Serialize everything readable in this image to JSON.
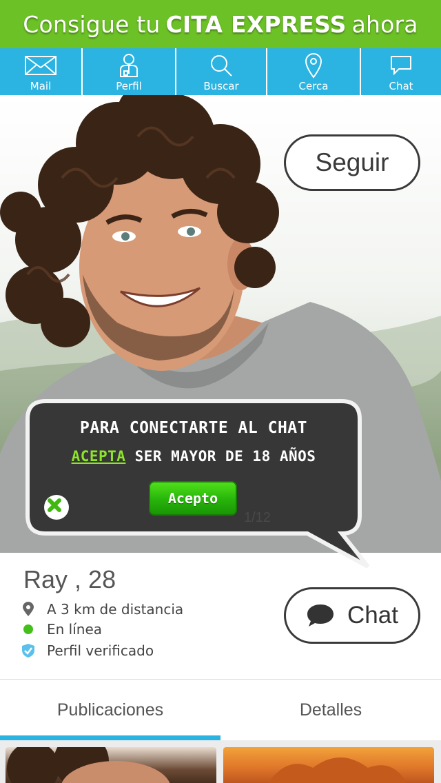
{
  "banner": {
    "text_pre": "Consigue tu",
    "text_bold": "CITA EXPRESS",
    "text_post": "ahora"
  },
  "nav": {
    "items": [
      {
        "label": "Mail",
        "icon": "mail-icon"
      },
      {
        "label": "Perfil",
        "icon": "profile-icon"
      },
      {
        "label": "Buscar",
        "icon": "search-icon"
      },
      {
        "label": "Cerca",
        "icon": "location-pin-icon"
      },
      {
        "label": "Chat",
        "icon": "chat-bubble-icon"
      }
    ]
  },
  "profile": {
    "follow_label": "Seguir",
    "name": "Ray",
    "age_text": ", 28",
    "distance": "A 3 km de distancia",
    "status": "En línea",
    "verified": "Perfil verificado",
    "chat_label": "Chat",
    "photo_counter": "1/12"
  },
  "modal": {
    "line1": "Para conectarte al chat",
    "accept_word": "Acepta",
    "line2_rest": " ser mayor de 18 años",
    "accept_button": "Acepto"
  },
  "tabs": [
    {
      "label": "Publicaciones",
      "active": true
    },
    {
      "label": "Detalles",
      "active": false
    }
  ],
  "colors": {
    "banner_green": "#6cc126",
    "nav_blue": "#2bb3e1",
    "online_green": "#43c11a",
    "accept_green": "#27b30a",
    "verified_blue": "#5bc0eb"
  }
}
